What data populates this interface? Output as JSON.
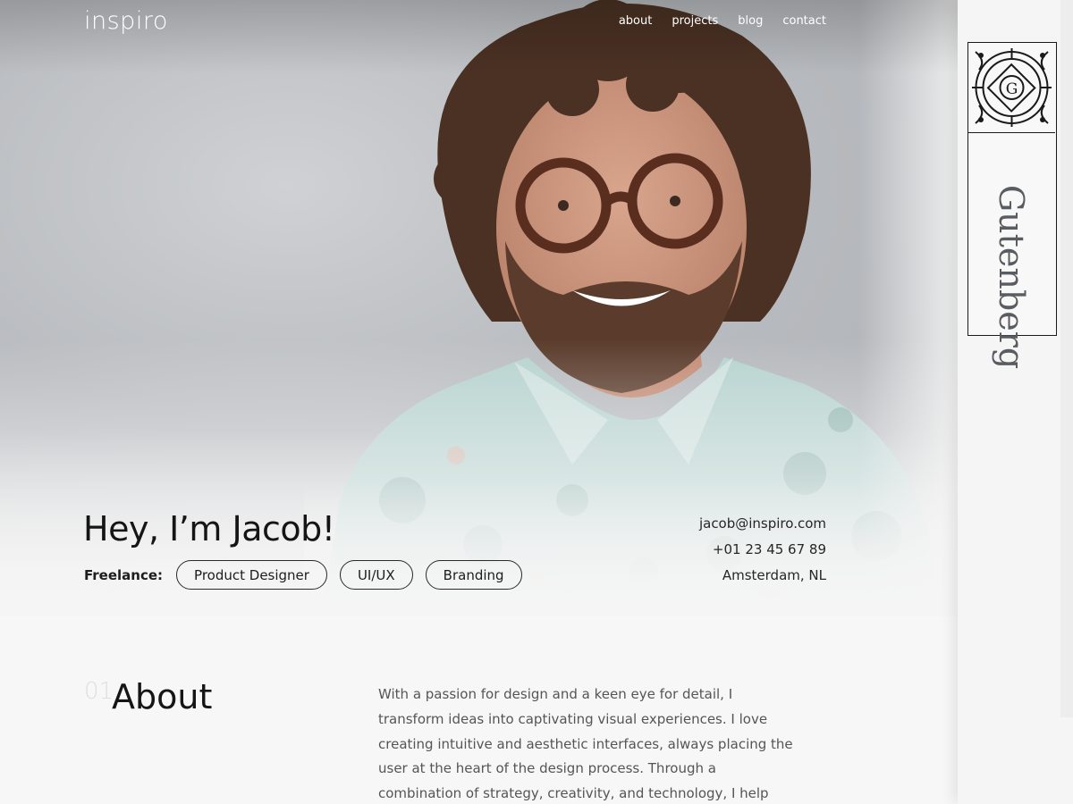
{
  "brand": {
    "logo": "inspiro"
  },
  "nav": [
    "about",
    "projects",
    "blog",
    "contact"
  ],
  "hero": {
    "title": "Hey, I’m Jacob!",
    "freelance_label": "Freelance:",
    "chips": [
      "Product Designer",
      "UI/UX",
      "Branding"
    ],
    "contact": {
      "email": "jacob@inspiro.com",
      "phone": "+01 23 45 67 89",
      "location": "Amsterdam, NL"
    }
  },
  "about": {
    "number": "01",
    "title": "About",
    "text": "With a passion for design and a keen eye for detail, I transform ideas into captivating visual experiences. I love creating intuitive and aesthetic interfaces, always placing the user at the heart of the design process. Through a combination of strategy, creativity, and technology, I help brands"
  },
  "badge": {
    "word": "Gutenberg",
    "seal_letter": "G"
  },
  "colors": {
    "text": "#151515",
    "body_text": "#555555",
    "background": "#f7f7f7",
    "nav_text": "#ffffff"
  }
}
